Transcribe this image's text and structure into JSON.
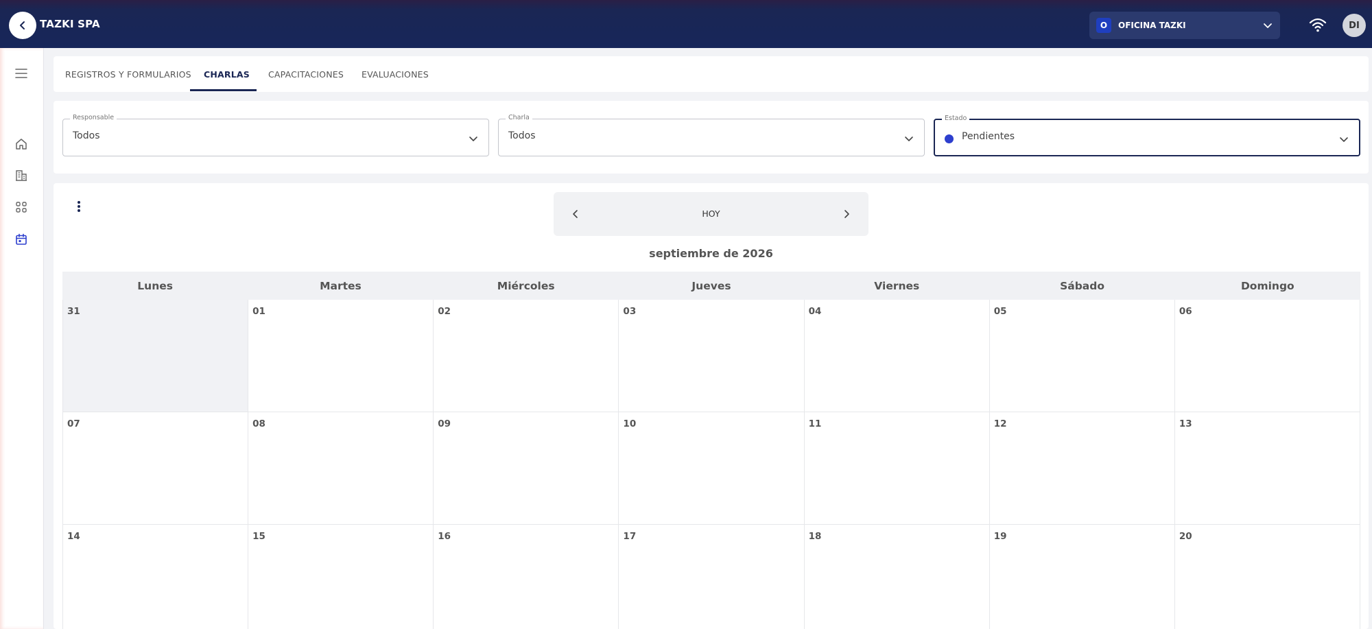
{
  "header": {
    "company": "TAZKI SPA",
    "office": {
      "badge": "O",
      "name": "OFICINA TAZKI"
    },
    "user_initials": "DI"
  },
  "sidebar": {
    "icons": [
      "menu-icon",
      "home-icon",
      "building-icon",
      "apps-grid-icon",
      "calendar-icon"
    ]
  },
  "tabs": [
    {
      "label": "REGISTROS Y FORMULARIOS",
      "active": false
    },
    {
      "label": "CHARLAS",
      "active": true
    },
    {
      "label": "CAPACITACIONES",
      "active": false
    },
    {
      "label": "EVALUACIONES",
      "active": false
    }
  ],
  "filters": {
    "responsable": {
      "label": "Responsable",
      "value": "Todos"
    },
    "charla": {
      "label": "Charla",
      "value": "Todos"
    },
    "estado": {
      "label": "Estado",
      "value": "Pendientes",
      "dot_color": "#2d3fce"
    }
  },
  "calendar": {
    "today_label": "HOY",
    "month_title": "septiembre de 2026",
    "day_names": [
      "Lunes",
      "Martes",
      "Miércoles",
      "Jueves",
      "Viernes",
      "Sábado",
      "Domingo"
    ],
    "weeks": [
      [
        "31",
        "01",
        "02",
        "03",
        "04",
        "05",
        "06"
      ],
      [
        "07",
        "08",
        "09",
        "10",
        "11",
        "12",
        "13"
      ],
      [
        "14",
        "15",
        "16",
        "17",
        "18",
        "19",
        "20"
      ]
    ],
    "other_month_days": [
      "31"
    ]
  },
  "colors": {
    "navy": "#1a2654",
    "accent_blue": "#2d3fce"
  }
}
